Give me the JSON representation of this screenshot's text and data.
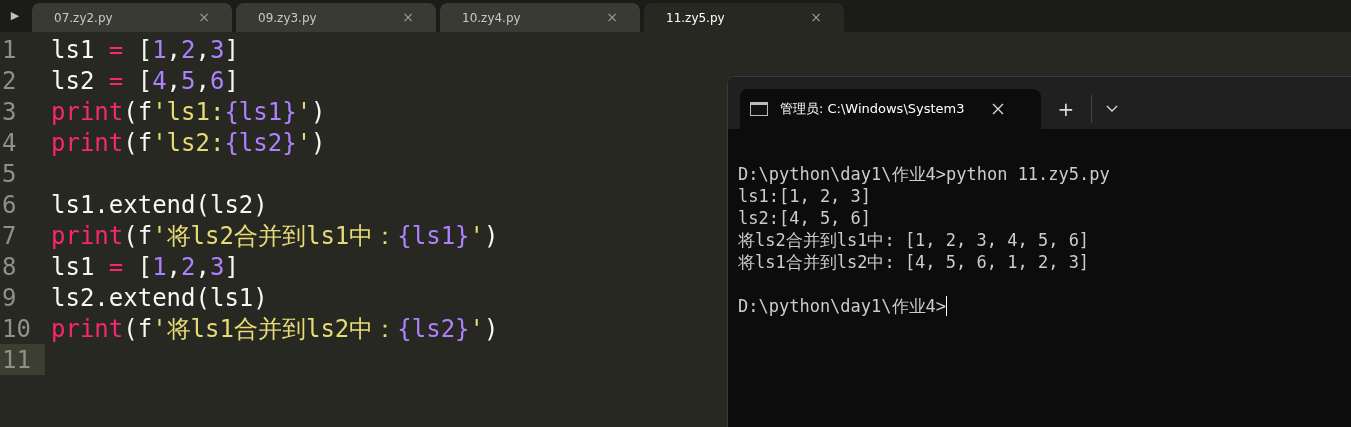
{
  "tab_bar": {
    "menu_glyph": "▶",
    "tabs": [
      {
        "label": "07.zy2.py",
        "selected": false,
        "close": "×"
      },
      {
        "label": "09.zy3.py",
        "selected": false,
        "close": "×"
      },
      {
        "label": "10.zy4.py",
        "selected": false,
        "close": "×"
      },
      {
        "label": "11.zy5.py",
        "selected": true,
        "close": "×"
      }
    ]
  },
  "editor": {
    "lines": [
      {
        "number": "1",
        "current": false,
        "tokens": [
          {
            "kind": "plain",
            "text": "ls1 "
          },
          {
            "kind": "operator",
            "text": "="
          },
          {
            "kind": "plain",
            "text": " ["
          },
          {
            "kind": "number",
            "text": "1"
          },
          {
            "kind": "plain",
            "text": ","
          },
          {
            "kind": "number",
            "text": "2"
          },
          {
            "kind": "plain",
            "text": ","
          },
          {
            "kind": "number",
            "text": "3"
          },
          {
            "kind": "plain",
            "text": "]"
          }
        ]
      },
      {
        "number": "2",
        "current": false,
        "tokens": [
          {
            "kind": "plain",
            "text": "ls2 "
          },
          {
            "kind": "operator",
            "text": "="
          },
          {
            "kind": "plain",
            "text": " ["
          },
          {
            "kind": "number",
            "text": "4"
          },
          {
            "kind": "plain",
            "text": ","
          },
          {
            "kind": "number",
            "text": "5"
          },
          {
            "kind": "plain",
            "text": ","
          },
          {
            "kind": "number",
            "text": "6"
          },
          {
            "kind": "plain",
            "text": "]"
          }
        ]
      },
      {
        "number": "3",
        "current": false,
        "tokens": [
          {
            "kind": "keyword",
            "text": "print"
          },
          {
            "kind": "plain",
            "text": "(f"
          },
          {
            "kind": "string",
            "text": "'ls1:"
          },
          {
            "kind": "interp",
            "text": "{ls1}"
          },
          {
            "kind": "string",
            "text": "'"
          },
          {
            "kind": "plain",
            "text": ")"
          }
        ]
      },
      {
        "number": "4",
        "current": false,
        "tokens": [
          {
            "kind": "keyword",
            "text": "print"
          },
          {
            "kind": "plain",
            "text": "(f"
          },
          {
            "kind": "string",
            "text": "'ls2:"
          },
          {
            "kind": "interp",
            "text": "{ls2}"
          },
          {
            "kind": "string",
            "text": "'"
          },
          {
            "kind": "plain",
            "text": ")"
          }
        ]
      },
      {
        "number": "5",
        "current": false
      },
      {
        "number": "6",
        "current": false,
        "tokens": [
          {
            "kind": "plain",
            "text": "ls1.extend(ls2)"
          }
        ]
      },
      {
        "number": "7",
        "current": false,
        "tokens": [
          {
            "kind": "keyword",
            "text": "print"
          },
          {
            "kind": "plain",
            "text": "(f"
          },
          {
            "kind": "string",
            "text": "'将ls2合并到ls1中："
          },
          {
            "kind": "interp",
            "text": "{ls1}"
          },
          {
            "kind": "string",
            "text": "'"
          },
          {
            "kind": "plain",
            "text": ")"
          }
        ]
      },
      {
        "number": "8",
        "current": false,
        "tokens": [
          {
            "kind": "plain",
            "text": "ls1 "
          },
          {
            "kind": "operator",
            "text": "="
          },
          {
            "kind": "plain",
            "text": " ["
          },
          {
            "kind": "number",
            "text": "1"
          },
          {
            "kind": "plain",
            "text": ","
          },
          {
            "kind": "number",
            "text": "2"
          },
          {
            "kind": "plain",
            "text": ","
          },
          {
            "kind": "number",
            "text": "3"
          },
          {
            "kind": "plain",
            "text": "]"
          }
        ]
      },
      {
        "number": "9",
        "current": false,
        "tokens": [
          {
            "kind": "plain",
            "text": "ls2.extend(ls1)"
          }
        ]
      },
      {
        "number": "10",
        "current": false,
        "tokens": [
          {
            "kind": "keyword",
            "text": "print"
          },
          {
            "kind": "plain",
            "text": "(f"
          },
          {
            "kind": "string",
            "text": "'将ls1合并到ls2中："
          },
          {
            "kind": "interp",
            "text": "{ls2}"
          },
          {
            "kind": "string",
            "text": "'"
          },
          {
            "kind": "plain",
            "text": ")"
          }
        ]
      },
      {
        "number": "11",
        "current": true
      }
    ]
  },
  "terminal": {
    "tab_title": "管理员: C:\\Windows\\System3",
    "new_tab": "+",
    "cursor": true,
    "blocks": [
      {
        "lines": [
          "D:\\python\\day1\\作业4>python 11.zy5.py",
          "ls1:[1, 2, 3]",
          "ls2:[4, 5, 6]",
          "将ls2合并到ls1中: [1, 2, 3, 4, 5, 6]",
          "将ls1合并到ls2中: [4, 5, 6, 1, 2, 3]"
        ]
      },
      {
        "lines": [
          "D:\\python\\day1\\作业4>"
        ]
      }
    ]
  }
}
